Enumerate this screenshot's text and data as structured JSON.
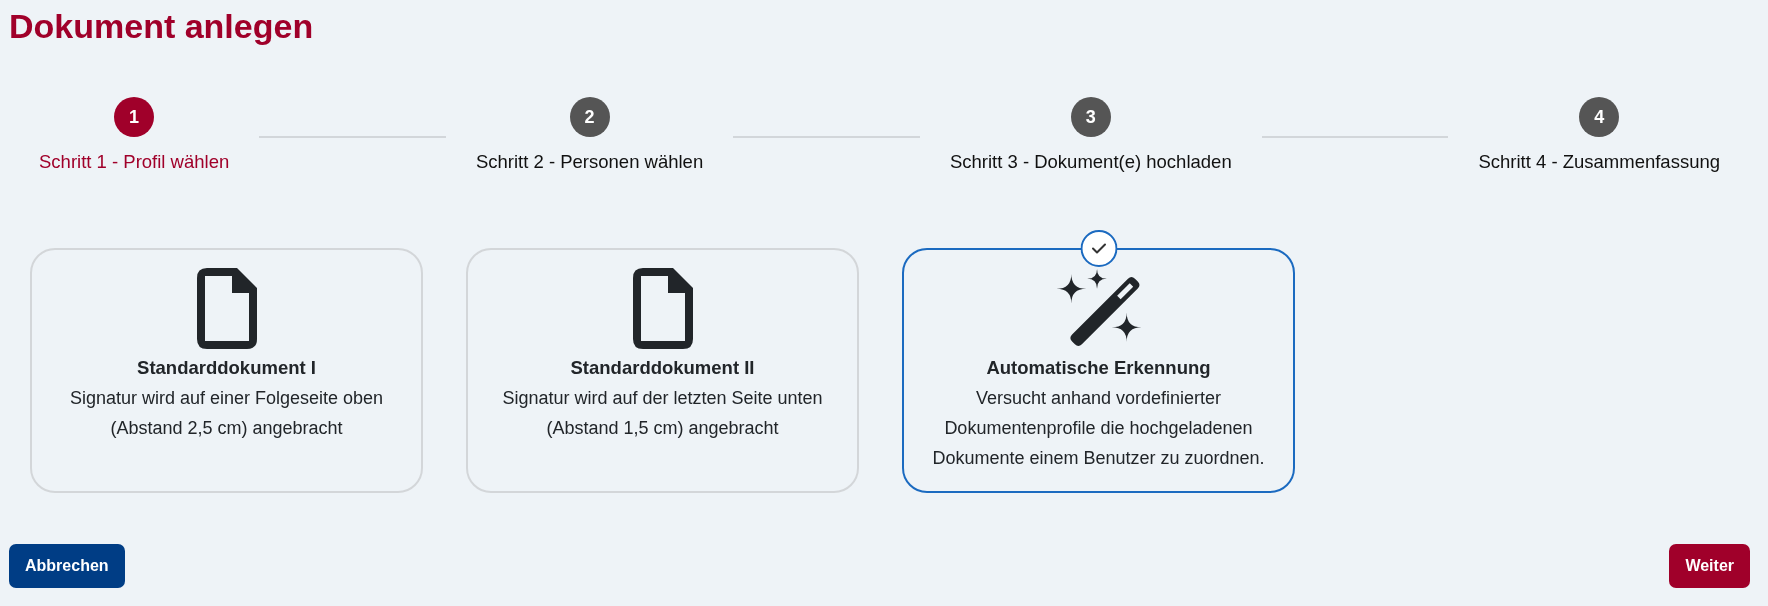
{
  "title": "Dokument anlegen",
  "steps": [
    {
      "number": "1",
      "label": "Schritt 1 - Profil wählen",
      "active": true
    },
    {
      "number": "2",
      "label": "Schritt 2 - Personen wählen",
      "active": false
    },
    {
      "number": "3",
      "label": "Schritt 3 - Dokument(e) hochladen",
      "active": false
    },
    {
      "number": "4",
      "label": "Schritt 4 - Zusammenfassung",
      "active": false
    }
  ],
  "profiles": [
    {
      "kind": "document",
      "title": "Standarddokument I",
      "description": "Signatur wird auf einer Folgeseite oben (Abstand 2,5 cm) angebracht",
      "selected": false
    },
    {
      "kind": "document",
      "title": "Standarddokument II",
      "description": "Signatur wird auf der letzten Seite unten (Abstand 1,5 cm) angebracht",
      "selected": false
    },
    {
      "kind": "wand",
      "title": "Automatische Erkennung",
      "description": "Versucht anhand vordefinierter Dokumentenprofile die hochgeladenen Dokumente einem Benutzer zu zuordnen.",
      "selected": true
    }
  ],
  "buttons": [
    {
      "kind": "cancel",
      "label": "Abbrechen"
    },
    {
      "kind": "next",
      "label": "Weiter"
    }
  ]
}
